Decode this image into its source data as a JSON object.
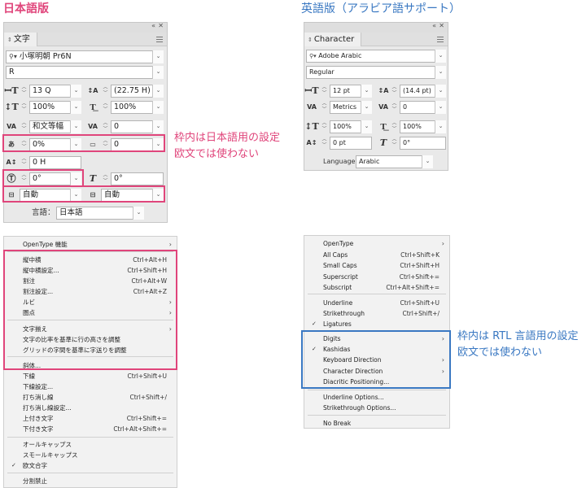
{
  "headings": {
    "ja": "日本語版",
    "en": "英語版（アラビア語サポート）"
  },
  "ja_panel": {
    "tab_title": "文字",
    "font_family": "小塚明朝 Pr6N",
    "font_style": "R",
    "font_size": "13 Q",
    "leading": "(22.75 H)",
    "vertical_scale": "100%",
    "horizontal_scale": "100%",
    "kerning": "和文等幅",
    "tracking": "0",
    "tsume": "0%",
    "aki": "0",
    "baseline_shift": "0 H",
    "rotation": "0°",
    "skew": "0°",
    "aki_before": "自動",
    "aki_after": "自動",
    "language_label": "言語：",
    "language": "日本語"
  },
  "en_panel": {
    "tab_title": "Character",
    "font_family": "Adobe Arabic",
    "font_style": "Regular",
    "font_size": "12 pt",
    "leading": "(14.4 pt)",
    "kerning": "Metrics",
    "tracking": "0",
    "vertical_scale": "100%",
    "horizontal_scale": "100%",
    "baseline_shift": "0 pt",
    "skew": "0°",
    "language_label": "Language:",
    "language": "Arabic"
  },
  "notes": {
    "pink_line1": "枠内は日本語用の設定",
    "pink_line2": "欧文では使わない",
    "blue_line1": "枠内は RTL 言語用の設定",
    "blue_line2": "欧文では使わない"
  },
  "ja_menu": {
    "items": [
      {
        "label": "OpenType 機能",
        "shortcut": "",
        "submenu": true,
        "check": false
      },
      {
        "label": "縦中横",
        "shortcut": "Ctrl+Alt+H",
        "submenu": false,
        "check": false
      },
      {
        "label": "縦中横設定...",
        "shortcut": "Ctrl+Shift+H",
        "submenu": false,
        "check": false
      },
      {
        "label": "割注",
        "shortcut": "Ctrl+Alt+W",
        "submenu": false,
        "check": false
      },
      {
        "label": "割注設定...",
        "shortcut": "Ctrl+Alt+Z",
        "submenu": false,
        "check": false
      },
      {
        "label": "ルビ",
        "shortcut": "",
        "submenu": true,
        "check": false
      },
      {
        "label": "圏点",
        "shortcut": "",
        "submenu": true,
        "check": false
      },
      {
        "label": "文字揃え",
        "shortcut": "",
        "submenu": true,
        "check": false
      },
      {
        "label": "文字の比率を基準に行の高さを調整",
        "shortcut": "",
        "submenu": false,
        "check": false
      },
      {
        "label": "グリッドの字間を基準に字送りを調整",
        "shortcut": "",
        "submenu": false,
        "check": false
      },
      {
        "label": "斜体...",
        "shortcut": "",
        "submenu": false,
        "check": false
      },
      {
        "label": "下線",
        "shortcut": "Ctrl+Shift+U",
        "submenu": false,
        "check": false
      },
      {
        "label": "下線設定...",
        "shortcut": "",
        "submenu": false,
        "check": false
      },
      {
        "label": "打ち消し線",
        "shortcut": "Ctrl+Shift+/",
        "submenu": false,
        "check": false
      },
      {
        "label": "打ち消し線設定...",
        "shortcut": "",
        "submenu": false,
        "check": false
      },
      {
        "label": "上付き文字",
        "shortcut": "Ctrl+Shift+=",
        "submenu": false,
        "check": false
      },
      {
        "label": "下付き文字",
        "shortcut": "Ctrl+Alt+Shift+=",
        "submenu": false,
        "check": false
      },
      {
        "label": "オールキャップス",
        "shortcut": "",
        "submenu": false,
        "check": false
      },
      {
        "label": "スモールキャップス",
        "shortcut": "",
        "submenu": false,
        "check": false
      },
      {
        "label": "欧文合字",
        "shortcut": "",
        "submenu": false,
        "check": true
      },
      {
        "label": "分割禁止",
        "shortcut": "",
        "submenu": false,
        "check": false
      }
    ]
  },
  "en_menu": {
    "items": [
      {
        "label": "OpenType",
        "shortcut": "",
        "submenu": true,
        "check": false
      },
      {
        "label": "All Caps",
        "shortcut": "Ctrl+Shift+K",
        "submenu": false,
        "check": false
      },
      {
        "label": "Small Caps",
        "shortcut": "Ctrl+Shift+H",
        "submenu": false,
        "check": false
      },
      {
        "label": "Superscript",
        "shortcut": "Ctrl+Shift+=",
        "submenu": false,
        "check": false
      },
      {
        "label": "Subscript",
        "shortcut": "Ctrl+Alt+Shift+=",
        "submenu": false,
        "check": false
      },
      {
        "label": "Underline",
        "shortcut": "Ctrl+Shift+U",
        "submenu": false,
        "check": false
      },
      {
        "label": "Strikethrough",
        "shortcut": "Ctrl+Shift+/",
        "submenu": false,
        "check": false
      },
      {
        "label": "Ligatures",
        "shortcut": "",
        "submenu": false,
        "check": true
      },
      {
        "label": "Digits",
        "shortcut": "",
        "submenu": true,
        "check": false
      },
      {
        "label": "Kashidas",
        "shortcut": "",
        "submenu": false,
        "check": true
      },
      {
        "label": "Keyboard Direction",
        "shortcut": "",
        "submenu": true,
        "check": false
      },
      {
        "label": "Character Direction",
        "shortcut": "",
        "submenu": true,
        "check": false
      },
      {
        "label": "Diacritic Positioning...",
        "shortcut": "",
        "submenu": false,
        "check": false
      },
      {
        "label": "Underline Options...",
        "shortcut": "",
        "submenu": false,
        "check": false
      },
      {
        "label": "Strikethrough Options...",
        "shortcut": "",
        "submenu": false,
        "check": false
      },
      {
        "label": "No Break",
        "shortcut": "",
        "submenu": false,
        "check": false
      }
    ]
  }
}
